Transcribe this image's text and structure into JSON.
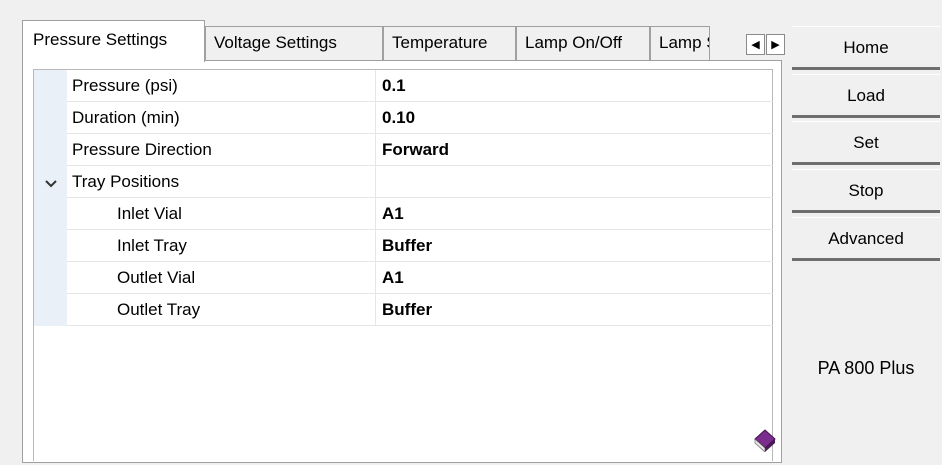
{
  "tabs": [
    {
      "label": "Pressure Settings",
      "active": true
    },
    {
      "label": "Voltage Settings",
      "active": false
    },
    {
      "label": "Temperature",
      "active": false
    },
    {
      "label": "Lamp On/Off",
      "active": false
    },
    {
      "label": "Lamp Settings",
      "active": false
    }
  ],
  "tab_scroll": {
    "left_icon": "arrow-left-icon",
    "right_icon": "arrow-right-icon"
  },
  "properties": [
    {
      "name": "Pressure (psi)",
      "value": "0.1"
    },
    {
      "name": "Duration (min)",
      "value": "0.10"
    },
    {
      "name": "Pressure Direction",
      "value": "Forward"
    },
    {
      "name": "Tray Positions",
      "value": "",
      "expanded": true
    },
    {
      "name": "Inlet Vial",
      "value": "A1"
    },
    {
      "name": "Inlet Tray",
      "value": "Buffer"
    },
    {
      "name": "Outlet Vial",
      "value": "A1"
    },
    {
      "name": "Outlet Tray",
      "value": "Buffer"
    }
  ],
  "side_buttons": {
    "home": "Home",
    "load": "Load",
    "set": "Set",
    "stop": "Stop",
    "advanced": "Advanced"
  },
  "instrument_name": "PA 800 Plus",
  "colors": {
    "gutter": "#eaf0f8",
    "book": "#7b2d8e"
  }
}
